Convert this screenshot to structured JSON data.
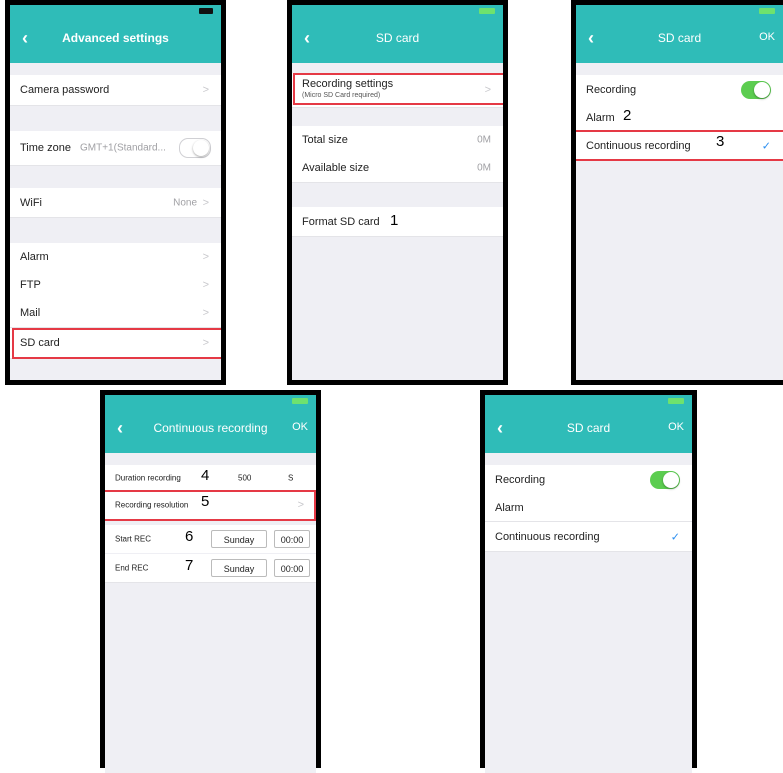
{
  "screen1": {
    "title": "Advanced settings",
    "camera_password": "Camera password",
    "time_zone_label": "Time zone",
    "time_zone_value": "GMT+1(Standard...",
    "wifi_label": "WiFi",
    "wifi_value": "None",
    "alarm": "Alarm",
    "ftp": "FTP",
    "mail": "Mail",
    "sd_card": "SD card",
    "chevron": ">"
  },
  "screen2": {
    "title": "SD card",
    "recording_settings": "Recording settings",
    "recording_settings_sub": "(Micro SD Card required)",
    "total_size_label": "Total size",
    "total_size_value": "0M",
    "available_size_label": "Available size",
    "available_size_value": "0M",
    "format_sd_card": "Format SD card",
    "step_number": "1"
  },
  "screen3": {
    "title": "SD card",
    "ok": "OK",
    "recording": "Recording",
    "recording_on": true,
    "alarm": "Alarm",
    "alarm_step": "2",
    "continuous": "Continuous recording",
    "continuous_step": "3",
    "check": "✓"
  },
  "screen4": {
    "title": "Continuous recording",
    "ok": "OK",
    "duration_label": "Duration recording",
    "duration_step": "4",
    "duration_value": "500",
    "duration_unit": "S",
    "resolution_label": "Recording resolution",
    "resolution_step": "5",
    "start_label": "Start REC",
    "start_step": "6",
    "start_day": "Sunday",
    "start_time": "00:00",
    "end_label": "End REC",
    "end_step": "7",
    "end_day": "Sunday",
    "end_time": "00:00"
  },
  "screen5": {
    "title": "SD card",
    "ok": "OK",
    "recording": "Recording",
    "recording_on": true,
    "alarm": "Alarm",
    "continuous": "Continuous recording",
    "check": "✓"
  },
  "colors": {
    "header_teal": "#2fbcb8",
    "highlight_red": "#e53945",
    "toggle_green": "#5ccd50",
    "check_blue": "#2a8ef0"
  }
}
